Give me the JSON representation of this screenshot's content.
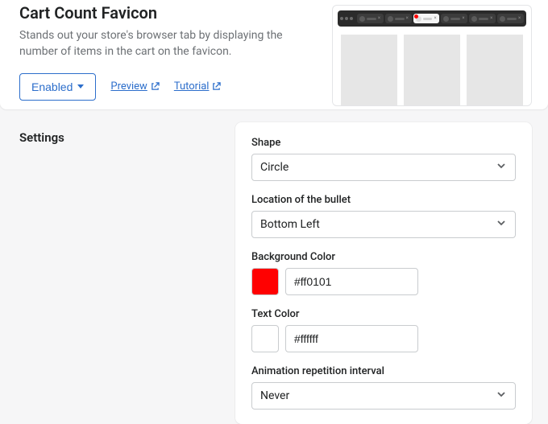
{
  "header": {
    "title": "Cart Count Favicon",
    "description": "Stands out your store's browser tab by displaying the number of items in the cart on the favicon.",
    "enabled_label": "Enabled",
    "preview_label": "Preview",
    "tutorial_label": "Tutorial"
  },
  "settings": {
    "heading": "Settings",
    "fields": {
      "shape": {
        "label": "Shape",
        "value": "Circle"
      },
      "location": {
        "label": "Location of the bullet",
        "value": "Bottom Left"
      },
      "bg_color": {
        "label": "Background Color",
        "value": "#ff0101"
      },
      "text_color": {
        "label": "Text Color",
        "value": "#ffffff"
      },
      "animation": {
        "label": "Animation repetition interval",
        "value": "Never"
      }
    }
  }
}
